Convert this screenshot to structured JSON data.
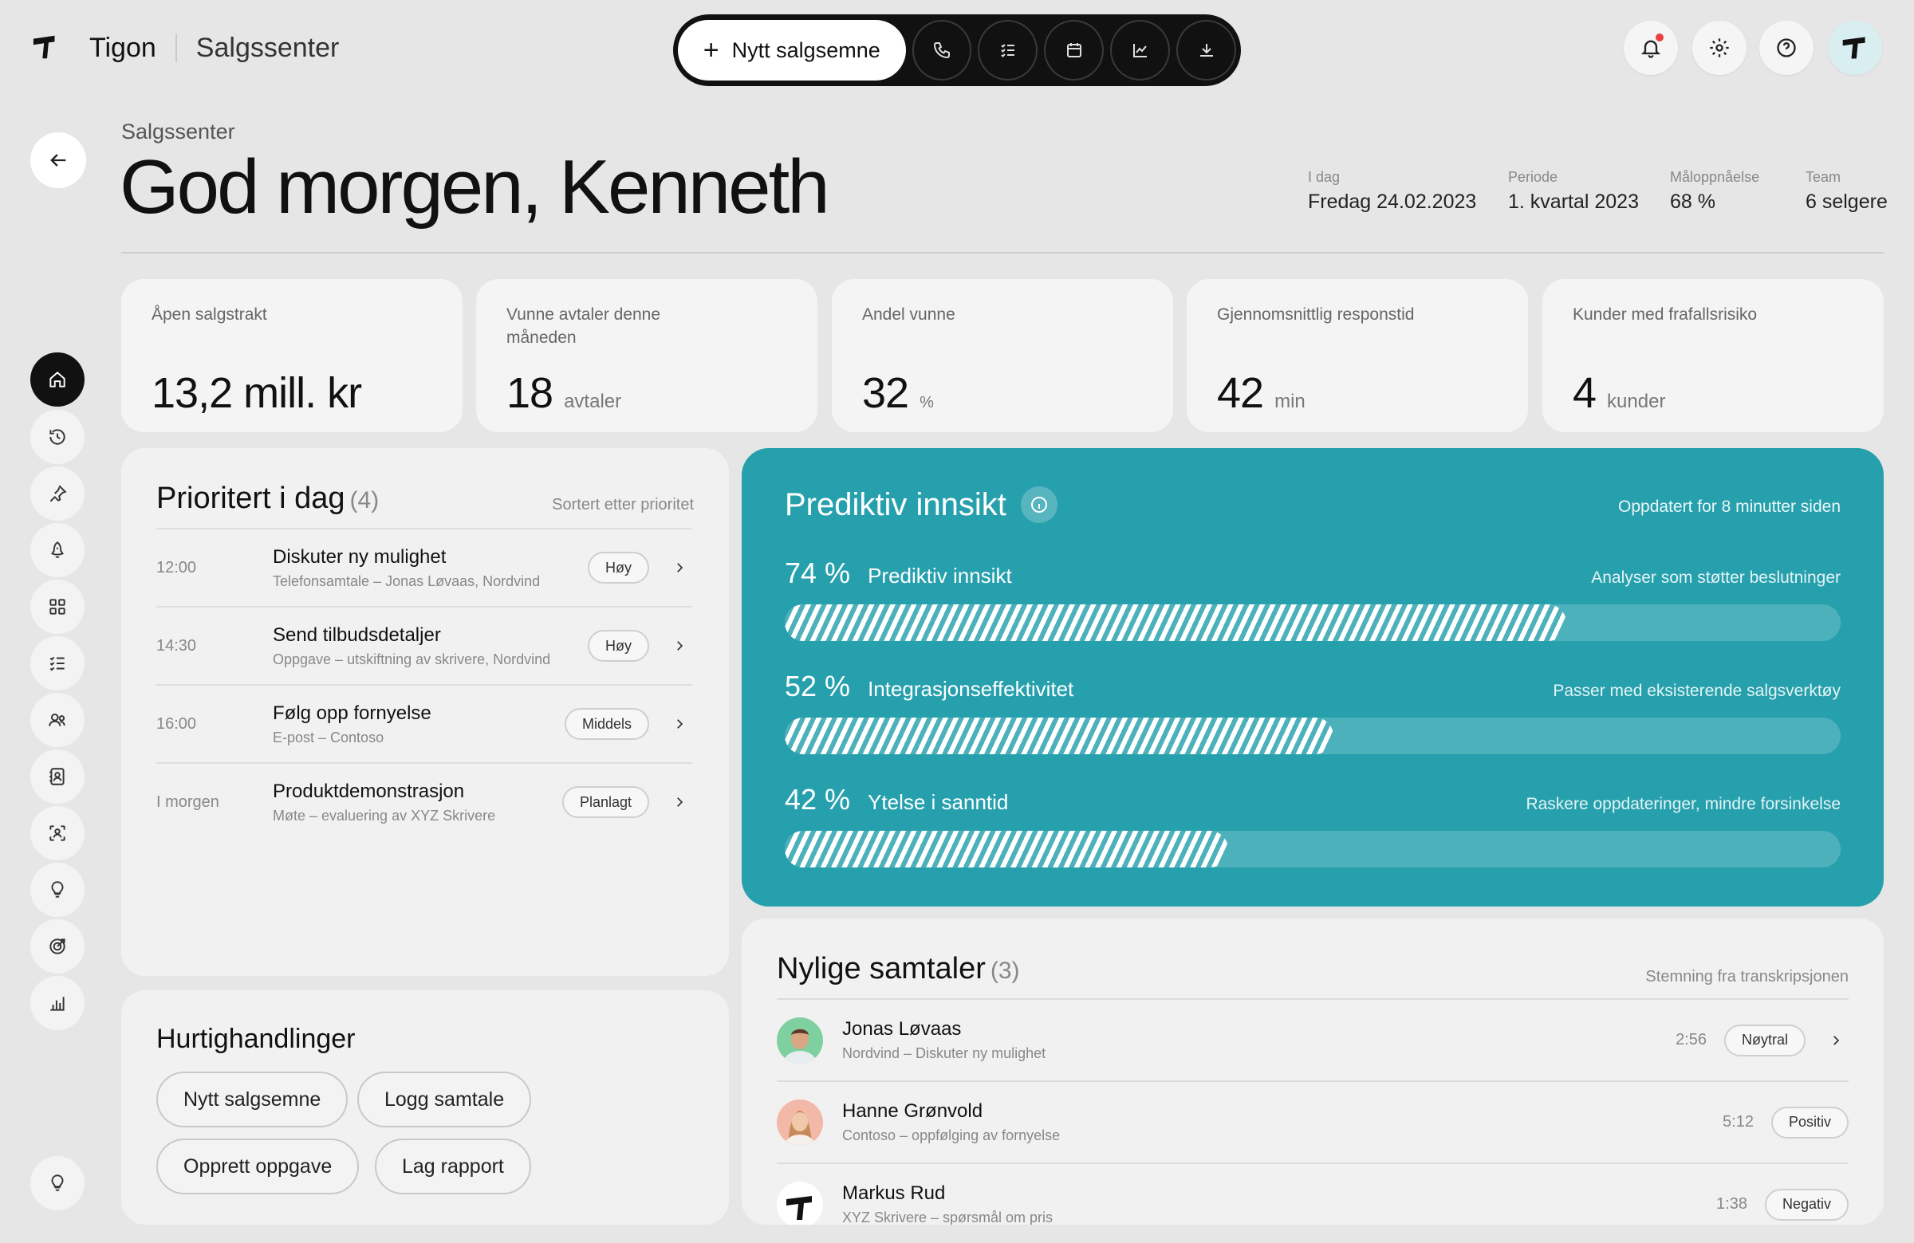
{
  "brand": {
    "name": "Tigon",
    "section": "Salgssenter"
  },
  "toolbar": {
    "primary_label": "Nytt salgsemne",
    "icons": [
      "phone-icon",
      "checklist-icon",
      "calendar-icon",
      "chart-icon",
      "download-icon"
    ]
  },
  "header": {
    "crumb": "Salgssenter",
    "greeting": "God morgen, Kenneth",
    "meta": [
      {
        "label": "I dag",
        "value": "Fredag 24.02.2023"
      },
      {
        "label": "Periode",
        "value": "1. kvartal 2023"
      },
      {
        "label": "Måloppnåelse",
        "value": "68 %"
      },
      {
        "label": "Team",
        "value": "6 selgere"
      }
    ]
  },
  "sidebar": {
    "icons": [
      "home-icon",
      "history-icon",
      "pin-icon",
      "rocket-icon",
      "grid-icon",
      "list-icon",
      "users-icon",
      "contacts-icon",
      "scan-person-icon",
      "lightbulb-icon",
      "target-icon",
      "bar-chart-icon"
    ],
    "bottom_icon": "lightbulb-icon"
  },
  "kpis": [
    {
      "label": "Åpen salgstrakt",
      "value": "13,2 mill. kr",
      "unit": ""
    },
    {
      "label": "Vunne avtaler denne måneden",
      "value": "18",
      "unit": "avtaler"
    },
    {
      "label": "Andel vunne",
      "value": "32",
      "unit": "%"
    },
    {
      "label": "Gjennomsnittlig responstid",
      "value": "42",
      "unit": "min"
    },
    {
      "label": "Kunder med frafallsrisiko",
      "value": "4",
      "unit": "kunder"
    }
  ],
  "priority": {
    "title": "Prioritert i dag",
    "count": "(4)",
    "sort_label": "Sortert etter prioritet",
    "items": [
      {
        "time": "12:00",
        "title": "Diskuter ny mulighet",
        "desc": "Telefonsamtale – Jonas Løvaas, Nordvind",
        "badge": "Høy"
      },
      {
        "time": "14:30",
        "title": "Send tilbudsdetaljer",
        "desc": "Oppgave – utskiftning av skrivere, Nordvind",
        "badge": "Høy"
      },
      {
        "time": "16:00",
        "title": "Følg opp fornyelse",
        "desc": "E-post – Contoso",
        "badge": "Middels"
      },
      {
        "time": "I morgen",
        "title": "Produktdemonstrasjon",
        "desc": "Møte – evaluering av XYZ Skrivere",
        "badge": "Planlagt"
      }
    ]
  },
  "predictive": {
    "title": "Prediktiv innsikt",
    "updated": "Oppdatert for 8 minutter siden",
    "metrics": [
      {
        "pct_label": "74 %",
        "value": 74,
        "name": "Prediktiv innsikt",
        "note": "Analyser som støtter beslutninger"
      },
      {
        "pct_label": "52 %",
        "value": 52,
        "name": "Integrasjonseffektivitet",
        "note": "Passer med eksisterende salgsverktøy"
      },
      {
        "pct_label": "42 %",
        "value": 42,
        "name": "Ytelse i sanntid",
        "note": "Raskere oppdateringer, mindre forsinkelse"
      }
    ]
  },
  "quick_actions": {
    "title": "Hurtighandlinger",
    "buttons": [
      "Nytt salgsemne",
      "Logg samtale",
      "Opprett oppgave",
      "Lag rapport"
    ]
  },
  "conversations": {
    "title": "Nylige samtaler",
    "count": "(3)",
    "subtitle": "Stemning fra transkripsjonen",
    "items": [
      {
        "name": "Jonas Løvaas",
        "desc": "Nordvind – Diskuter ny mulighet",
        "duration": "2:56",
        "sentiment": "Nøytral"
      },
      {
        "name": "Hanne Grønvold",
        "desc": "Contoso – oppfølging av fornyelse",
        "duration": "5:12",
        "sentiment": "Positiv"
      },
      {
        "name": "Markus Rud",
        "desc": "XYZ Skrivere – spørsmål om pris",
        "duration": "1:38",
        "sentiment": "Negativ"
      }
    ]
  },
  "colors": {
    "accent": "#27a0ad",
    "dark": "#111111",
    "background": "#e6e6e6",
    "card": "#f4f4f4",
    "notification": "#e84040"
  }
}
